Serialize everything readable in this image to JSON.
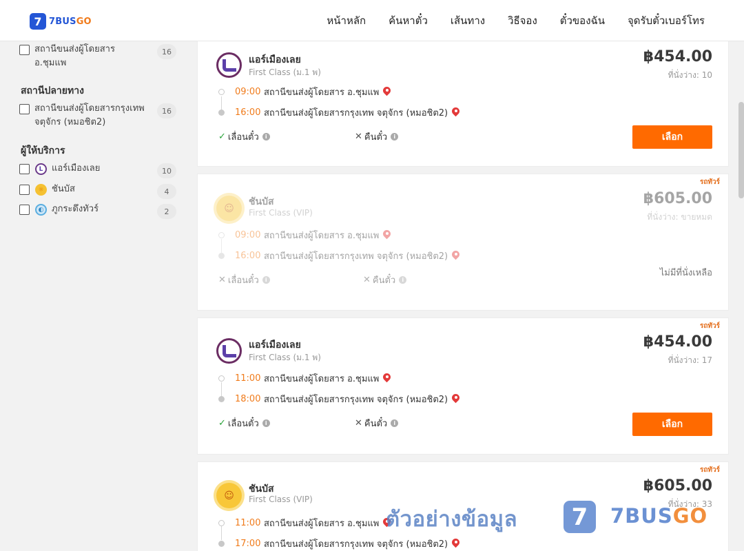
{
  "header": {
    "logo_number": "7",
    "logo_text_main": "7BUS",
    "logo_text_accent": "GO",
    "nav": [
      "หน้าหลัก",
      "ค้นหาตั๋ว",
      "เส้นทาง",
      "วิธีจอง",
      "ตั๋วของฉัน",
      "จุดรับตั๋วเบอร์โทร"
    ]
  },
  "sidebar": {
    "origin_item": {
      "label": "สถานีขนส่งผู้โดยสาร อ.ชุมแพ",
      "count": "16"
    },
    "destination_title": "สถานีปลายทาง",
    "destination_item": {
      "label": "สถานีขนส่งผู้โดยสารกรุงเทพ จตุจักร (หมอชิต2)",
      "count": "16"
    },
    "operator_title": "ผู้ให้บริการ",
    "operators": [
      {
        "label": "แอร์เมืองเลย",
        "count": "10",
        "icon": "air-mueang-loei-logo-icon"
      },
      {
        "label": "ชันบัส",
        "count": "4",
        "icon": "chanbus-sun-logo-icon"
      },
      {
        "label": "ภูกระดึงทัวร์",
        "count": "2",
        "icon": "phukradueng-tour-logo-icon"
      }
    ]
  },
  "trips": [
    {
      "ribbon": "",
      "operator": "แอร์เมืองเลย",
      "class": "First Class (ม.1 พ)",
      "price": "฿454.00",
      "seats": "ที่นั่งว่าง: 10",
      "depart_time": "09:00",
      "depart_station": "สถานีขนส่งผู้โดยสาร อ.ชุมแพ",
      "arrive_time": "16:00",
      "arrive_station": "สถานีขนส่งผู้โดยสารกรุงเทพ จตุจักร (หมอชิต2)",
      "reschedule": "เลื่อนตั๋ว",
      "refund": "คืนตั๋ว",
      "reschedule_ok": true,
      "refund_ok": false,
      "action": "เลือก"
    },
    {
      "ribbon": "รถทัวร์",
      "operator": "ชันบัส",
      "class": "First Class (VIP)",
      "price": "฿605.00",
      "seats": "ที่นั่งว่าง: ขายหมด",
      "depart_time": "09:00",
      "depart_station": "สถานีขนส่งผู้โดยสาร อ.ชุมแพ",
      "arrive_time": "16:00",
      "arrive_station": "สถานีขนส่งผู้โดยสารกรุงเทพ จตุจักร (หมอชิต2)",
      "reschedule": "เลื่อนตั๋ว",
      "refund": "คืนตั๋ว",
      "reschedule_ok": false,
      "refund_ok": false,
      "soldout": "ไม่มีที่นั่งเหลือ"
    },
    {
      "ribbon": "รถทัวร์",
      "operator": "แอร์เมืองเลย",
      "class": "First Class (ม.1 พ)",
      "price": "฿454.00",
      "seats": "ที่นั่งว่าง: 17",
      "depart_time": "11:00",
      "depart_station": "สถานีขนส่งผู้โดยสาร อ.ชุมแพ",
      "arrive_time": "18:00",
      "arrive_station": "สถานีขนส่งผู้โดยสารกรุงเทพ จตุจักร (หมอชิต2)",
      "reschedule": "เลื่อนตั๋ว",
      "refund": "คืนตั๋ว",
      "reschedule_ok": true,
      "refund_ok": false,
      "action": "เลือก"
    },
    {
      "ribbon": "รถทัวร์",
      "operator": "ชันบัส",
      "class": "First Class (VIP)",
      "price": "฿605.00",
      "seats": "ที่นั่งว่าง: 33",
      "depart_time": "11:00",
      "depart_station": "สถานีขนส่งผู้โดยสาร อ.ชุมแพ",
      "arrive_time": "17:00",
      "arrive_station": "สถานีขนส่งผู้โดยสารกรุงเทพ จตุจักร (หมอชิต2)"
    }
  ],
  "icons": {
    "ok": "✓",
    "no": "✕",
    "info": "i"
  },
  "watermark": {
    "text": "ตัวอย่างข้อมูล",
    "logo_number": "7",
    "brand_main": "7BUS",
    "brand_accent": "GO"
  },
  "colors": {
    "brand_blue": "#2456d6",
    "brand_orange": "#f07b1b",
    "button_orange": "#ff6a00",
    "pin_red": "#e33a3a",
    "check_green": "#2aa33a"
  }
}
